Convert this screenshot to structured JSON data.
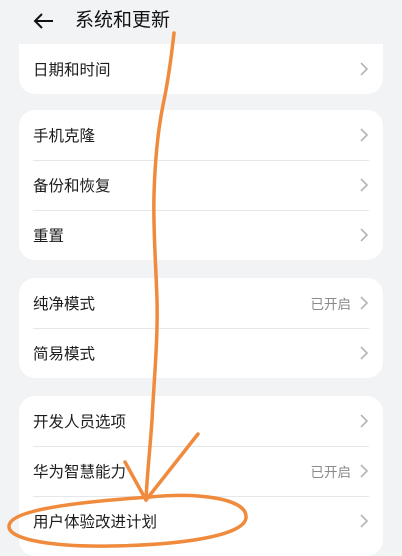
{
  "header": {
    "title": "系统和更新",
    "back_icon": "arrow-left-icon"
  },
  "groups": [
    {
      "items": [
        {
          "label": "日期和时间"
        }
      ]
    },
    {
      "items": [
        {
          "label": "手机克隆"
        },
        {
          "label": "备份和恢复"
        },
        {
          "label": "重置"
        }
      ]
    },
    {
      "items": [
        {
          "label": "纯净模式",
          "value": "已开启"
        },
        {
          "label": "简易模式"
        }
      ]
    },
    {
      "items": [
        {
          "label": "开发人员选项"
        },
        {
          "label": "华为智慧能力",
          "value": "已开启"
        },
        {
          "label": "用户体验改进计划"
        }
      ]
    }
  ],
  "annotation": {
    "color": "#f08a3c",
    "marks": [
      "freehand-arrow",
      "circle-around-last-item"
    ]
  }
}
